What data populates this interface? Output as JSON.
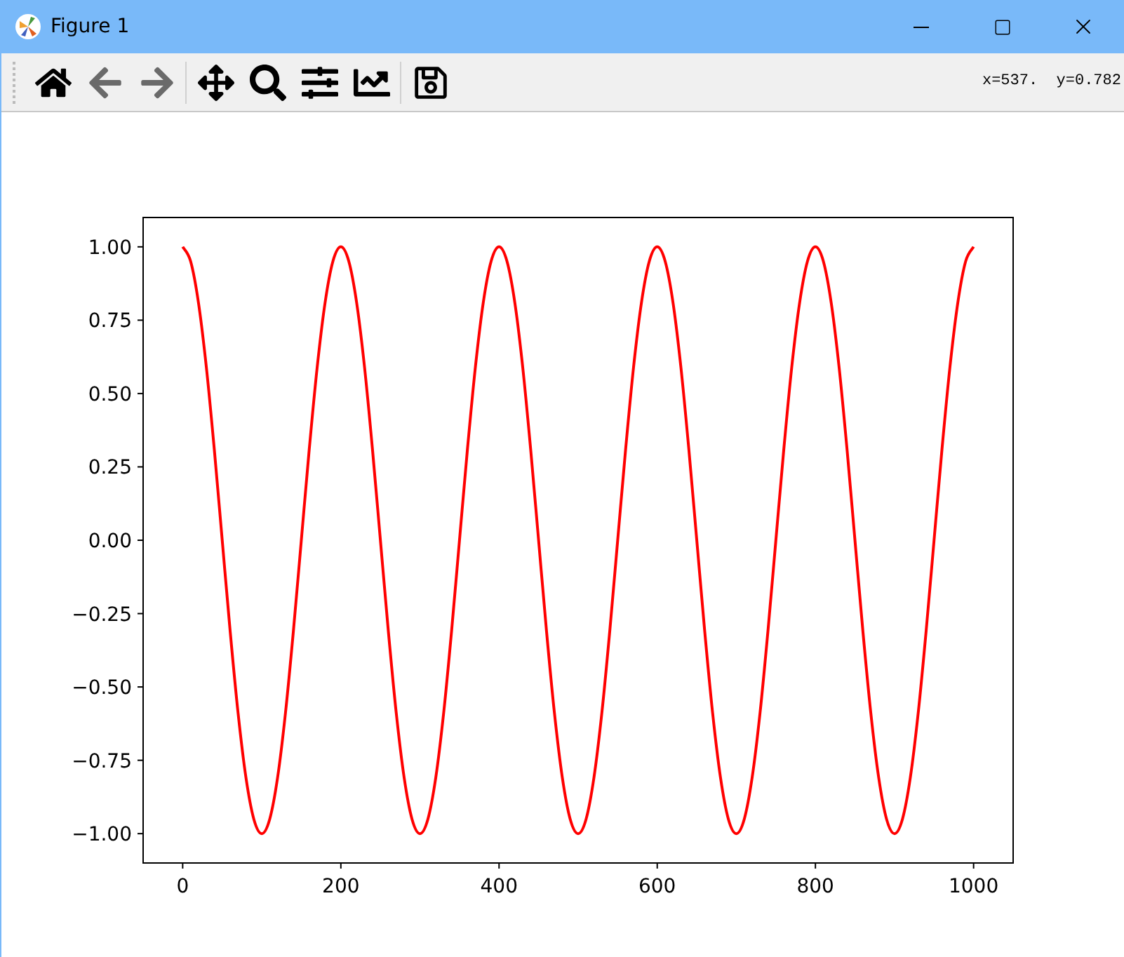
{
  "window": {
    "title": "Figure 1"
  },
  "toolbar": {
    "buttons": [
      {
        "kind": "home",
        "disabled": false
      },
      {
        "kind": "back",
        "disabled": true
      },
      {
        "kind": "forward",
        "disabled": true
      },
      {
        "kind": "pan",
        "disabled": false
      },
      {
        "kind": "zoom",
        "disabled": false
      },
      {
        "kind": "configure",
        "disabled": false
      },
      {
        "kind": "edit",
        "disabled": false
      },
      {
        "kind": "save",
        "disabled": false
      }
    ],
    "coordinates": "x=537.  y=0.782"
  },
  "figure": {
    "chart_data": {
      "type": "line",
      "xlim": [
        -50,
        1050
      ],
      "ylim": [
        -1.1,
        1.1
      ],
      "xticks": [
        0,
        200,
        400,
        600,
        800,
        1000
      ],
      "yticks": [
        {
          "value": 1,
          "label": "1.00"
        },
        {
          "value": 0.75,
          "label": "0.75"
        },
        {
          "value": 0.5,
          "label": "0.50"
        },
        {
          "value": 0.25,
          "label": "0.25"
        },
        {
          "value": 0,
          "label": "0.00"
        },
        {
          "value": -0.25,
          "label": "−0.25"
        },
        {
          "value": -0.5,
          "label": "−0.50"
        },
        {
          "value": -0.75,
          "label": "−0.75"
        },
        {
          "value": -1,
          "label": "−1.00"
        }
      ],
      "x": [
        0,
        10,
        20,
        30,
        40,
        50,
        60,
        70,
        80,
        90,
        100,
        110,
        120,
        130,
        140,
        150,
        160,
        170,
        180,
        190,
        200,
        210,
        220,
        230,
        240,
        250,
        260,
        270,
        280,
        290,
        300,
        310,
        320,
        330,
        340,
        350,
        360,
        370,
        380,
        390,
        400,
        410,
        420,
        430,
        440,
        450,
        460,
        470,
        480,
        490,
        500,
        510,
        520,
        530,
        540,
        550,
        560,
        570,
        580,
        590,
        600,
        610,
        620,
        630,
        640,
        650,
        660,
        670,
        680,
        690,
        700,
        710,
        720,
        730,
        740,
        750,
        760,
        770,
        780,
        790,
        800,
        810,
        820,
        830,
        840,
        850,
        860,
        870,
        880,
        890,
        900,
        910,
        920,
        930,
        940,
        950,
        960,
        970,
        980,
        990,
        1000
      ],
      "series": [
        {
          "color": "#ff0000",
          "values": [
            1,
            0.951,
            0.809,
            0.588,
            0.309,
            0,
            -0.309,
            -0.588,
            -0.809,
            -0.951,
            -1,
            -0.951,
            -0.809,
            -0.588,
            -0.309,
            0,
            0.309,
            0.588,
            0.809,
            0.951,
            1,
            0.951,
            0.809,
            0.588,
            0.309,
            0,
            -0.309,
            -0.588,
            -0.809,
            -0.951,
            -1,
            -0.951,
            -0.809,
            -0.588,
            -0.309,
            0,
            0.309,
            0.588,
            0.809,
            0.951,
            1,
            0.951,
            0.809,
            0.588,
            0.309,
            0,
            -0.309,
            -0.588,
            -0.809,
            -0.951,
            -1,
            -0.951,
            -0.809,
            -0.588,
            -0.309,
            0,
            0.309,
            0.588,
            0.809,
            0.951,
            1,
            0.951,
            0.809,
            0.588,
            0.309,
            0,
            -0.309,
            -0.588,
            -0.809,
            -0.951,
            -1,
            -0.951,
            -0.809,
            -0.588,
            -0.309,
            0,
            0.309,
            0.588,
            0.809,
            0.951,
            1,
            0.951,
            0.809,
            0.588,
            0.309,
            0,
            -0.309,
            -0.588,
            -0.809,
            -0.951,
            -1,
            -0.951,
            -0.809,
            -0.588,
            -0.309,
            0,
            0.309,
            0.588,
            0.809,
            0.951,
            1
          ]
        }
      ]
    }
  }
}
